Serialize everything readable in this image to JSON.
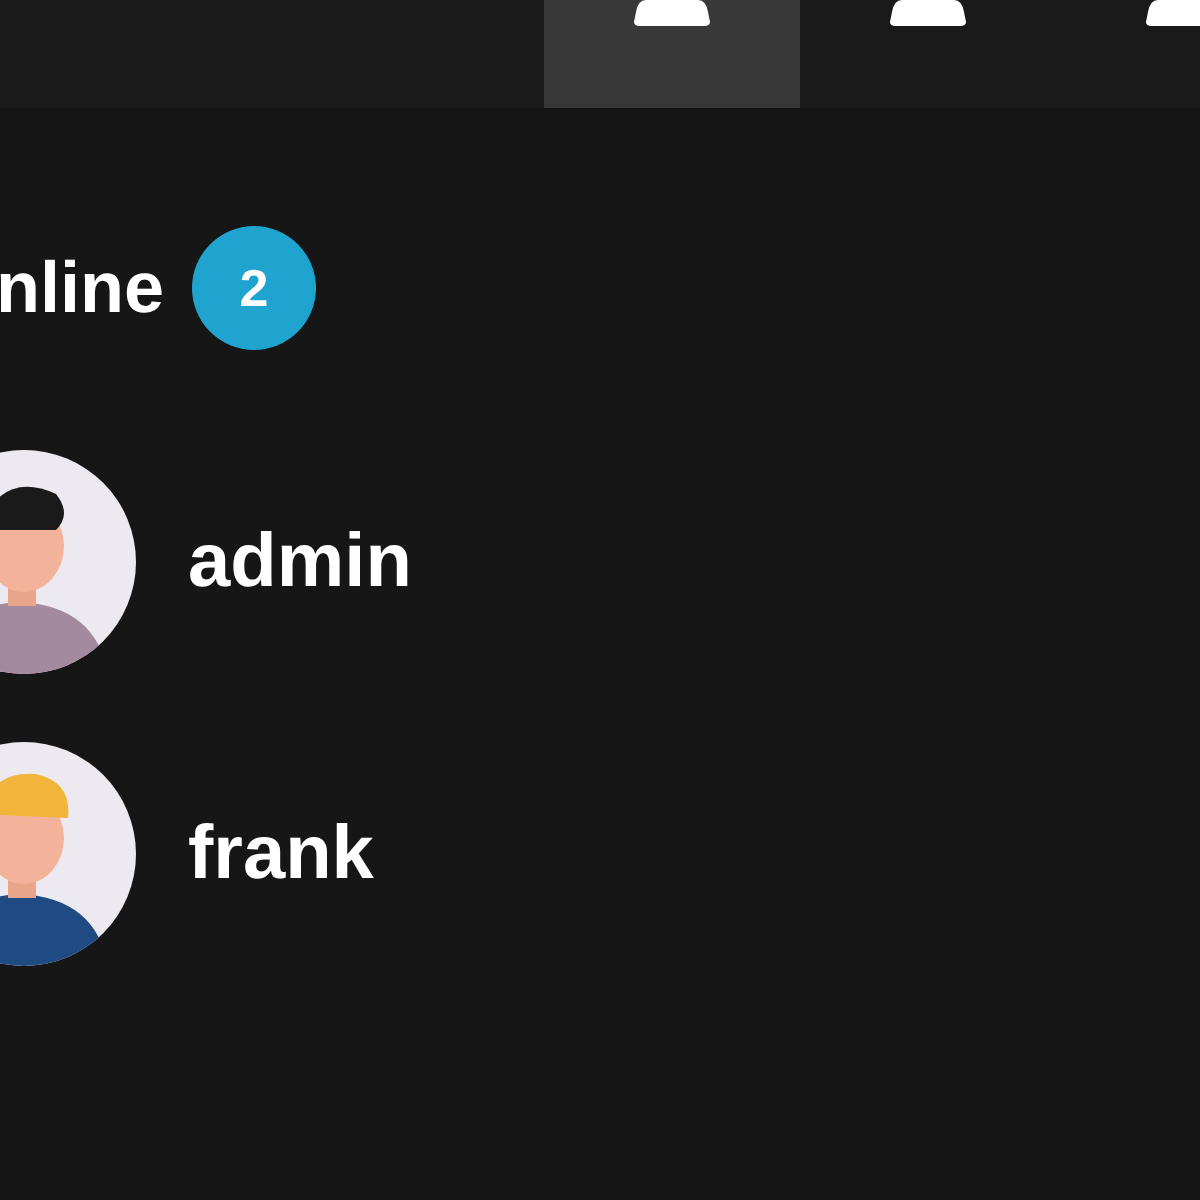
{
  "toolbar": {
    "buttons": [
      {
        "selected": true
      },
      {
        "selected": false
      },
      {
        "selected": false
      }
    ]
  },
  "online": {
    "title": "nline",
    "count": "2"
  },
  "users": [
    {
      "name": "admin",
      "kind": "curly"
    },
    {
      "name": "frank",
      "kind": "helmet"
    }
  ]
}
